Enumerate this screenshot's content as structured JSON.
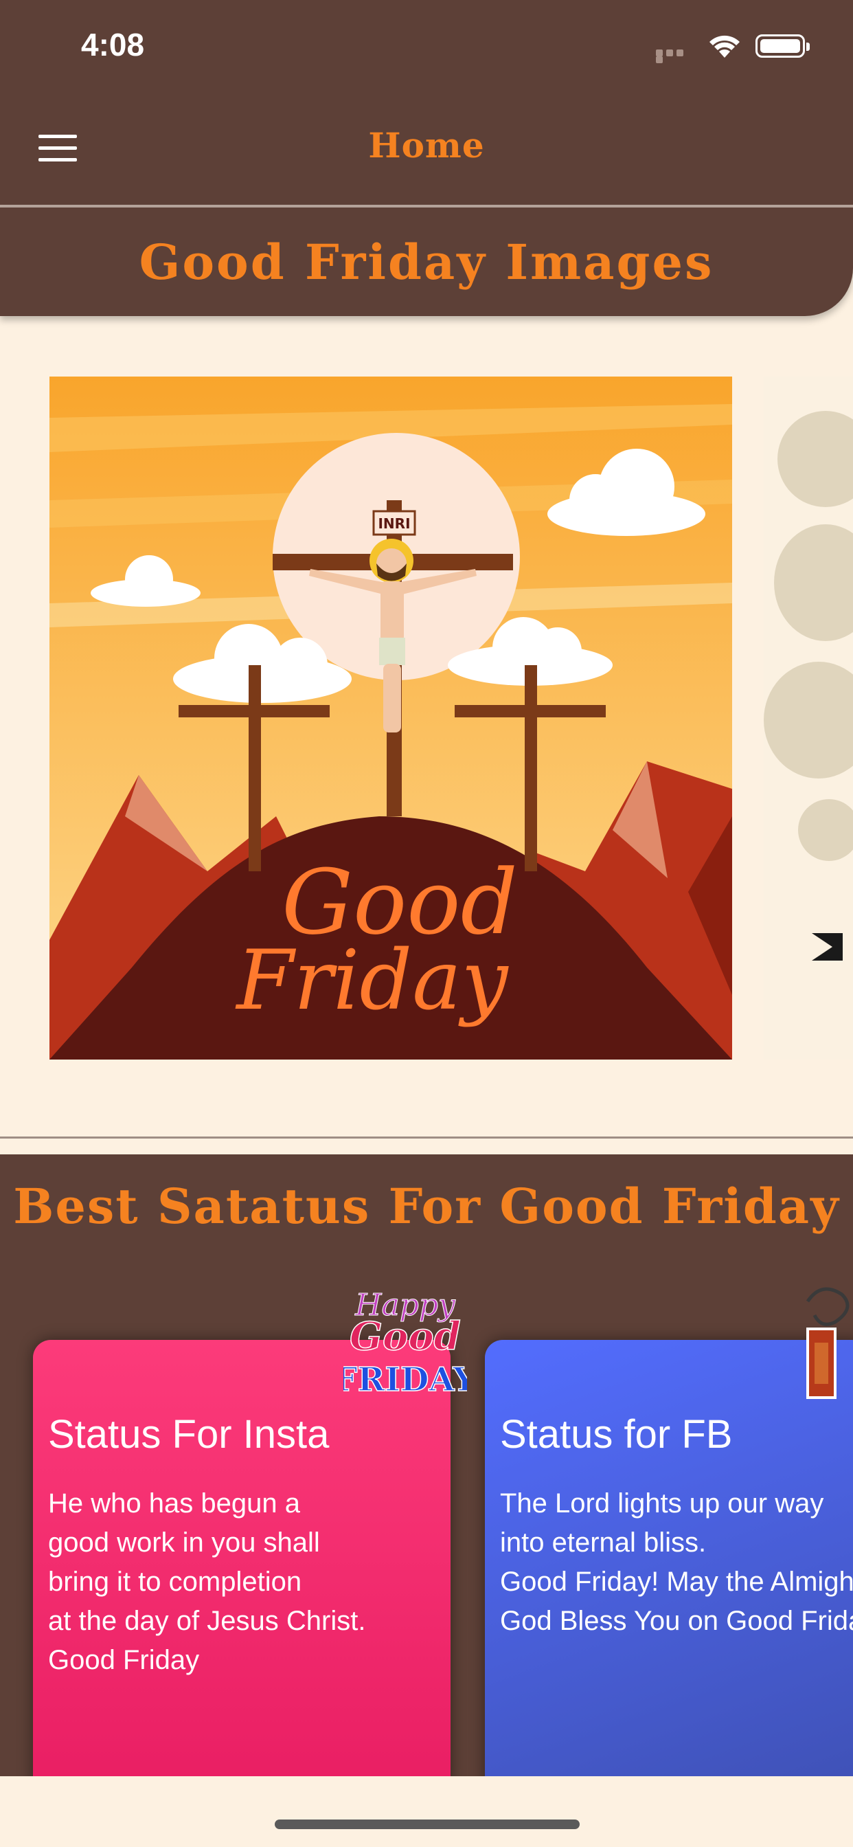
{
  "status_bar": {
    "time": "4:08"
  },
  "nav": {
    "title": "Home"
  },
  "header": {
    "title": "Good Friday Images"
  },
  "carousel": {
    "slides": [
      {
        "caption_line1": "Good",
        "caption_line2": "Friday",
        "sign": "INRI"
      }
    ]
  },
  "status_section": {
    "title": "Best Satatus For Good Friday",
    "cards": [
      {
        "title": "Status For Insta",
        "body": "He who has begun a\ngood work in you shall\nbring it to completion\nat the day of Jesus Christ.\nGood Friday",
        "logo_lines": [
          "Happy",
          "Good",
          "FRIDAY"
        ]
      },
      {
        "title": "Status for FB",
        "body": "The Lord lights up our way\ninto eternal bliss.\nGood Friday! May the Almighty\nGod Bless You on Good Friday"
      }
    ]
  },
  "colors": {
    "brown": "#5d4037",
    "orange": "#f58220",
    "cream": "#fdf1e1",
    "pink": "#e91e63",
    "blue": "#3f51b5"
  }
}
